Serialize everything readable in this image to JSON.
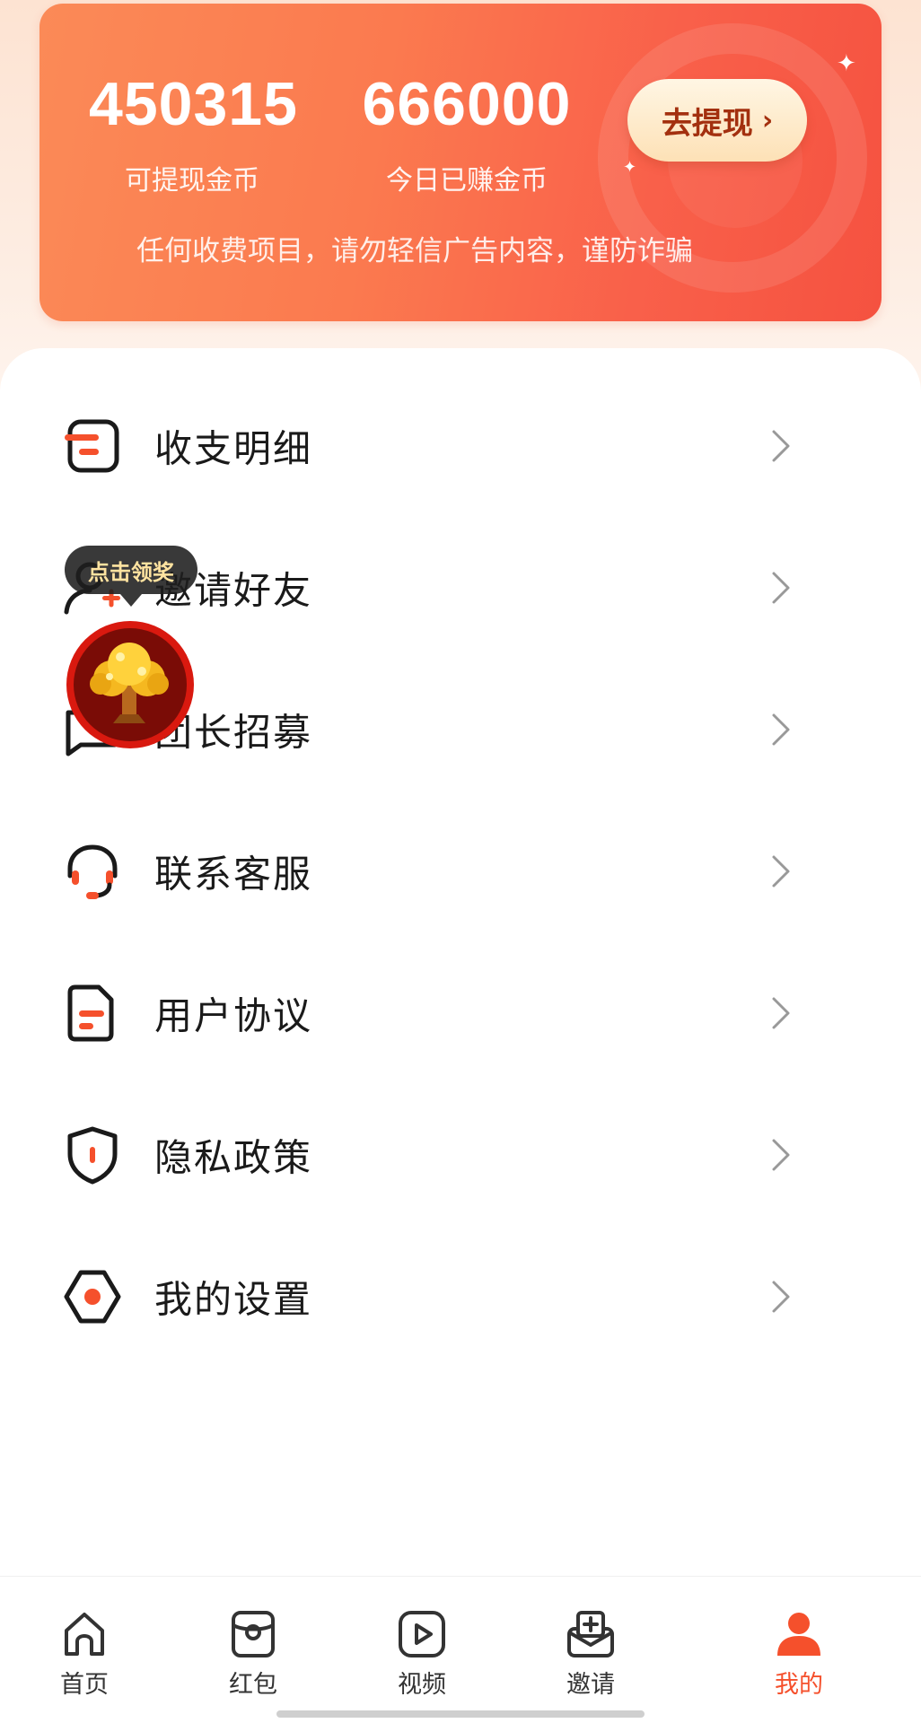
{
  "wallet": {
    "withdrawable_coins": "450315",
    "withdrawable_label": "可提现金币",
    "today_coins": "666000",
    "today_label": "今日已赚金币",
    "withdraw_button": "去提现",
    "withdraw_chevron": "›",
    "notice": "任何收费项目，请勿轻信广告内容，谨防诈骗"
  },
  "menu": {
    "items": [
      {
        "label": "收支明细",
        "icon": "ledger-icon"
      },
      {
        "label": "邀请好友",
        "icon": "invite-friend-icon"
      },
      {
        "label": "团长招募",
        "icon": "recruit-icon"
      },
      {
        "label": "联系客服",
        "icon": "headset-icon"
      },
      {
        "label": "用户协议",
        "icon": "document-icon"
      },
      {
        "label": "隐私政策",
        "icon": "shield-icon"
      },
      {
        "label": "我的设置",
        "icon": "settings-icon"
      }
    ]
  },
  "reward": {
    "bubble_text": "点击领奖",
    "icon": "money-tree-icon"
  },
  "tabbar": {
    "tabs": [
      {
        "label": "首页",
        "icon": "home-icon",
        "active": false
      },
      {
        "label": "红包",
        "icon": "red-packet-icon",
        "active": false
      },
      {
        "label": "视频",
        "icon": "video-icon",
        "active": false
      },
      {
        "label": "邀请",
        "icon": "invite-icon",
        "active": false
      },
      {
        "label": "我的",
        "icon": "profile-icon",
        "active": true
      }
    ]
  },
  "colors": {
    "accent": "#f5502c",
    "card_start": "#fb8a57",
    "card_end": "#f55240",
    "button_text": "#a3300f"
  }
}
